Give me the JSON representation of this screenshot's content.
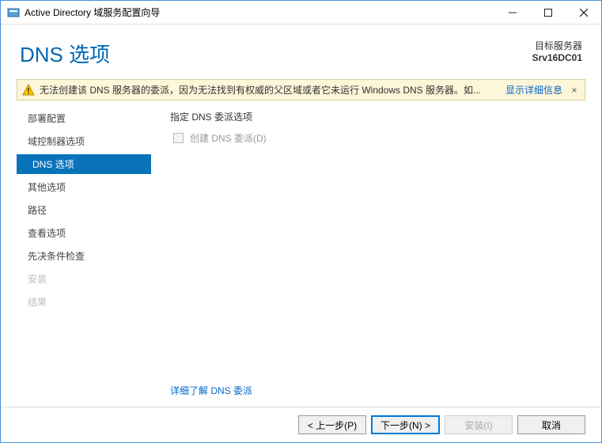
{
  "titlebar": {
    "title": "Active Directory 域服务配置向导"
  },
  "header": {
    "page_title": "DNS 选项",
    "target_label": "目标服务器",
    "target_server": "Srv16DC01"
  },
  "warning": {
    "message": "无法创建该 DNS 服务器的委派，因为无法找到有权威的父区域或者它未运行 Windows DNS 服务器。如...",
    "show_more": "显示详细信息",
    "close": "×"
  },
  "nav": {
    "items": [
      {
        "label": "部署配置",
        "state": "normal"
      },
      {
        "label": "域控制器选项",
        "state": "normal"
      },
      {
        "label": "DNS 选项",
        "state": "active"
      },
      {
        "label": "其他选项",
        "state": "normal"
      },
      {
        "label": "路径",
        "state": "normal"
      },
      {
        "label": "查看选项",
        "state": "normal"
      },
      {
        "label": "先决条件检查",
        "state": "normal"
      },
      {
        "label": "安装",
        "state": "disabled"
      },
      {
        "label": "结果",
        "state": "disabled"
      }
    ]
  },
  "content": {
    "section_label": "指定 DNS 委派选项",
    "checkbox_label": "创建 DNS 委派(D)",
    "more_link": "详细了解 DNS 委派"
  },
  "footer": {
    "prev": "< 上一步(P)",
    "next": "下一步(N) >",
    "install": "安装(I)",
    "cancel": "取消"
  }
}
